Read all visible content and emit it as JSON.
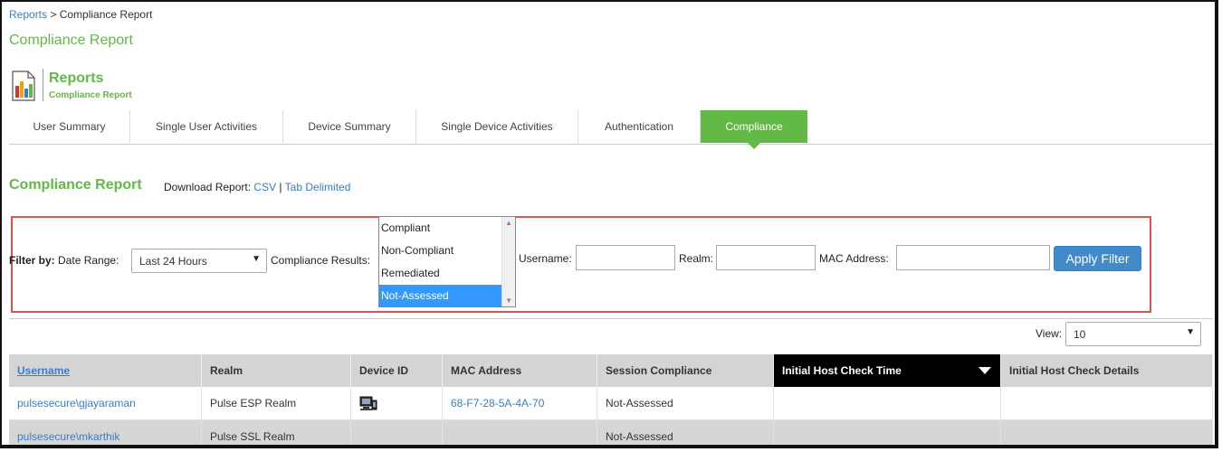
{
  "breadcrumb": {
    "root": "Reports",
    "separator": " > ",
    "current": "Compliance Report"
  },
  "page_title": "Compliance Report",
  "section": {
    "title": "Reports",
    "subtitle": "Compliance Report"
  },
  "tabs": [
    {
      "label": "User Summary"
    },
    {
      "label": "Single User Activities"
    },
    {
      "label": "Device Summary"
    },
    {
      "label": "Single Device Activities"
    },
    {
      "label": "Authentication"
    },
    {
      "label": "Compliance",
      "active": true
    }
  ],
  "report": {
    "title": "Compliance Report",
    "download_label": "Download Report:",
    "csv": "CSV",
    "divider": " | ",
    "tab_delimited": "Tab Delimited"
  },
  "filter": {
    "filter_by": "Filter by:",
    "date_range_label": "Date Range:",
    "date_range_value": "Last 24 Hours",
    "compliance_label": "Compliance Results:",
    "compliance_options": [
      "Compliant",
      "Non-Compliant",
      "Remediated",
      "Not-Assessed"
    ],
    "compliance_selected": "Not-Assessed",
    "username_label": "Username:",
    "realm_label": "Realm:",
    "mac_label": "MAC Address:",
    "apply_label": "Apply Filter"
  },
  "view": {
    "label": "View:",
    "value": "10"
  },
  "table": {
    "headers": [
      "Username",
      "Realm",
      "Device ID",
      "MAC Address",
      "Session Compliance",
      "Initial Host Check Time",
      "Initial Host Check Details"
    ],
    "rows": [
      {
        "username": "pulsesecure\\gjayaraman",
        "realm": "Pulse ESP Realm",
        "device_icon": "device-icon",
        "mac": "68-F7-28-5A-4A-70",
        "session": "Not-Assessed",
        "time": "",
        "details": ""
      },
      {
        "username": "pulsesecure\\mkarthik",
        "realm": "Pulse SSL Realm",
        "device_icon": "",
        "mac": "",
        "session": "Not-Assessed",
        "time": "",
        "details": ""
      }
    ]
  },
  "colors": {
    "accent_green": "#62b946",
    "link_blue": "#3a7dc8",
    "button_blue": "#428bca",
    "highlight_red": "#d9534f",
    "select_blue": "#3399ff"
  }
}
